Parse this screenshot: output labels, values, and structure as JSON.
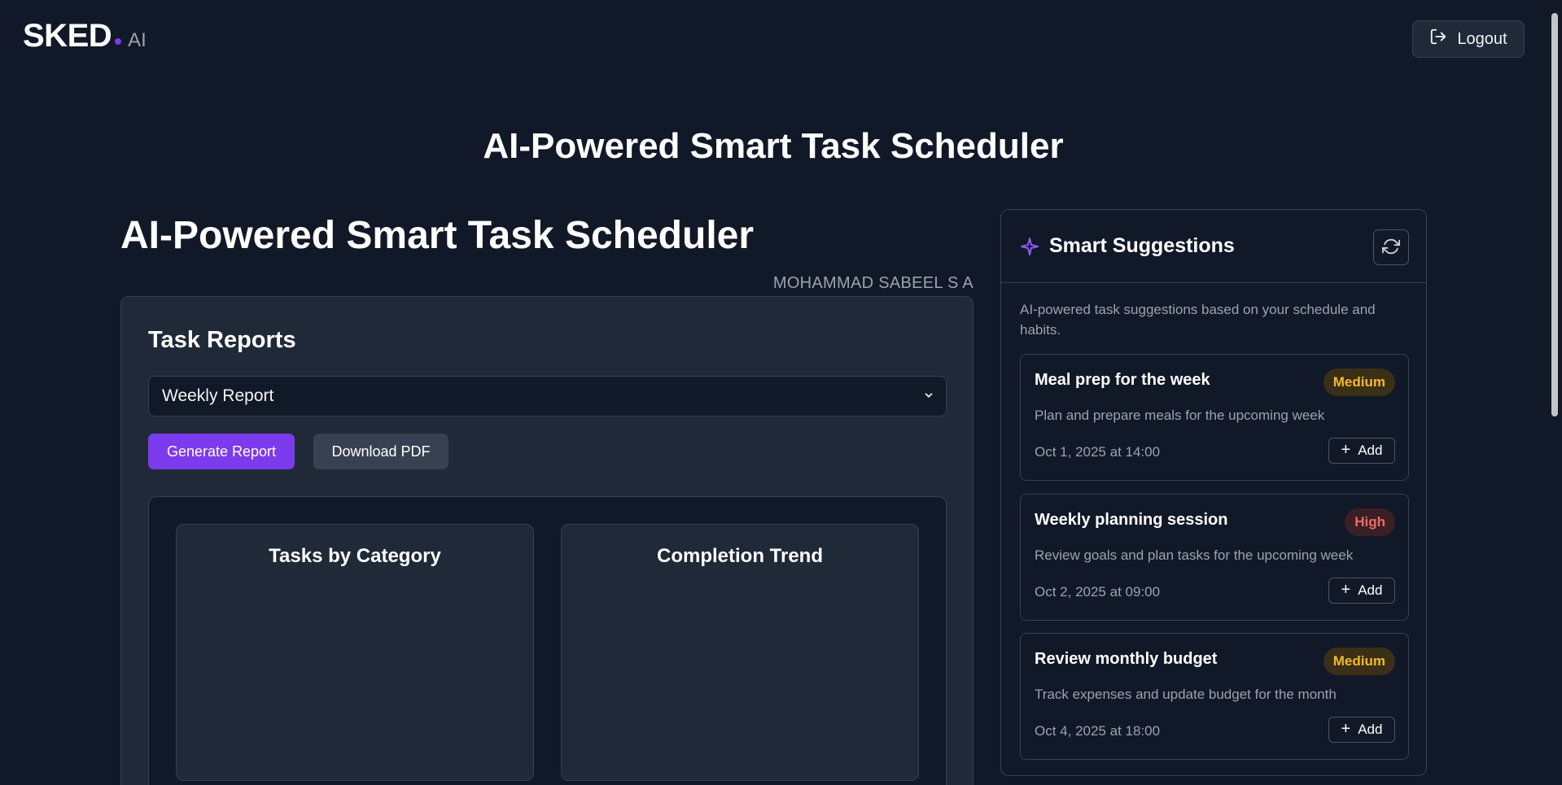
{
  "header": {
    "logo_main": "SKED",
    "logo_suffix": "AI",
    "logout_label": "Logout",
    "logout_icon": "logout-icon"
  },
  "page_heading": "AI-Powered Smart Task Scheduler",
  "main": {
    "title": "AI-Powered Smart Task Scheduler",
    "author": "MOHAMMAD SABEEL S A",
    "reports": {
      "title": "Task Reports",
      "select_value": "Weekly Report",
      "generate_label": "Generate Report",
      "download_label": "Download PDF",
      "charts": [
        {
          "title": "Tasks by Category"
        },
        {
          "title": "Completion Trend"
        }
      ]
    }
  },
  "suggestions": {
    "title": "Smart Suggestions",
    "icon": "sparkle-icon",
    "refresh_icon": "refresh-icon",
    "description": "AI-powered task suggestions based on your schedule and habits.",
    "items": [
      {
        "name": "Meal prep for the week",
        "priority": "Medium",
        "description": "Plan and prepare meals for the upcoming week",
        "date": "Oct 1, 2025 at 14:00",
        "add_label": "Add"
      },
      {
        "name": "Weekly planning session",
        "priority": "High",
        "description": "Review goals and plan tasks for the upcoming week",
        "date": "Oct 2, 2025 at 09:00",
        "add_label": "Add"
      },
      {
        "name": "Review monthly budget",
        "priority": "Medium",
        "description": "Track expenses and update budget for the month",
        "date": "Oct 4, 2025 at 18:00",
        "add_label": "Add"
      }
    ]
  },
  "colors": {
    "background": "#111827",
    "card": "#1f2937",
    "accent": "#7c3aed",
    "medium": "#f5b92a",
    "high": "#f06a6a"
  }
}
